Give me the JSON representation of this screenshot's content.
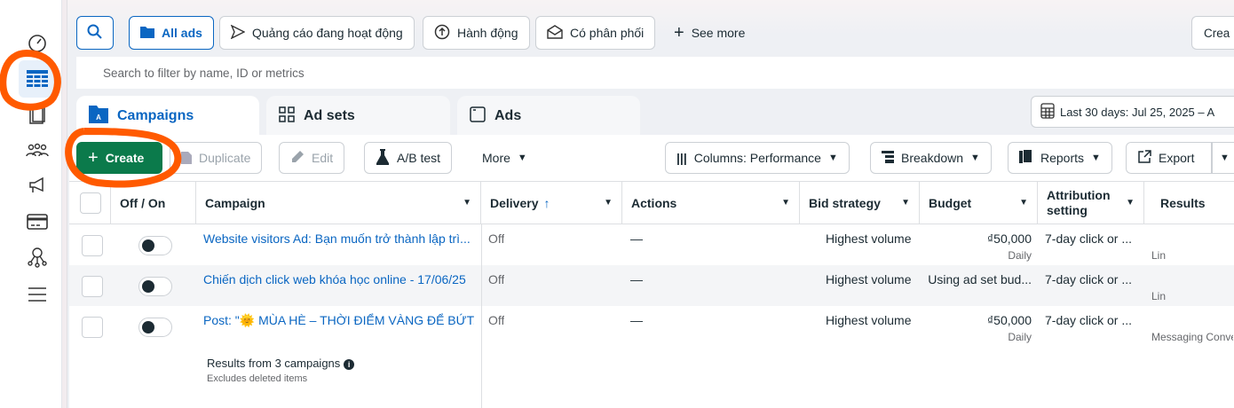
{
  "sidebar": {
    "items": [
      {
        "icon": "gauge-icon"
      },
      {
        "icon": "table-icon",
        "active": true
      },
      {
        "icon": "pages-icon"
      },
      {
        "icon": "audience-icon"
      },
      {
        "icon": "megaphone-icon"
      },
      {
        "icon": "billing-card-icon"
      },
      {
        "icon": "network-icon"
      },
      {
        "icon": "menu-icon"
      }
    ]
  },
  "filters": {
    "all_ads": "All ads",
    "active_ads": "Quảng cáo đang hoạt động",
    "actions": "Hành động",
    "delivered": "Có phân phối",
    "see_more": "See more",
    "create_right": "Crea"
  },
  "search": {
    "placeholder": "Search to filter by name, ID or metrics"
  },
  "tabs": [
    {
      "label": "Campaigns"
    },
    {
      "label": "Ad sets"
    },
    {
      "label": "Ads"
    }
  ],
  "date_range": "Last 30 days: Jul 25, 2025 – A",
  "toolbar": {
    "create": "Create",
    "duplicate": "Duplicate",
    "edit": "Edit",
    "ab_test": "A/B test",
    "more": "More",
    "columns": "Columns: Performance",
    "breakdown": "Breakdown",
    "reports": "Reports",
    "export": "Export"
  },
  "table": {
    "headers": {
      "toggle": "Off / On",
      "campaign": "Campaign",
      "delivery": "Delivery",
      "actions": "Actions",
      "bid": "Bid strategy",
      "budget": "Budget",
      "attribution_1": "Attribution",
      "attribution_2": "setting",
      "results": "Results"
    },
    "rows": [
      {
        "name": "Website visitors Ad: Bạn muốn trở thành lập trì...",
        "delivery": "Off",
        "actions": "—",
        "bid": "Highest volume",
        "budget": "₫50,000",
        "budget_sub": "Daily",
        "attribution": "7-day click or ...",
        "results_sub": "Lin"
      },
      {
        "name": "Chiến dịch click web khóa học online - 17/06/25",
        "delivery": "Off",
        "actions": "—",
        "bid": "Highest volume",
        "budget": "Using ad set bud...",
        "budget_sub": "",
        "attribution": "7-day click or ...",
        "results_sub": "Lin"
      },
      {
        "name": "Post: \"🌞 MÙA HÈ – THỜI ĐIỂM VÀNG ĐỂ BỨT...",
        "delivery": "Off",
        "actions": "—",
        "bid": "Highest volume",
        "budget": "₫50,000",
        "budget_sub": "Daily",
        "attribution": "7-day click or ...",
        "results_sub": "Messaging Conve"
      }
    ],
    "footer": {
      "title": "Results from 3 campaigns",
      "sub": "Excludes deleted items"
    }
  },
  "colors": {
    "accent": "#0a66c2",
    "create": "#0b7a4b",
    "annotation": "#ff5a00"
  }
}
